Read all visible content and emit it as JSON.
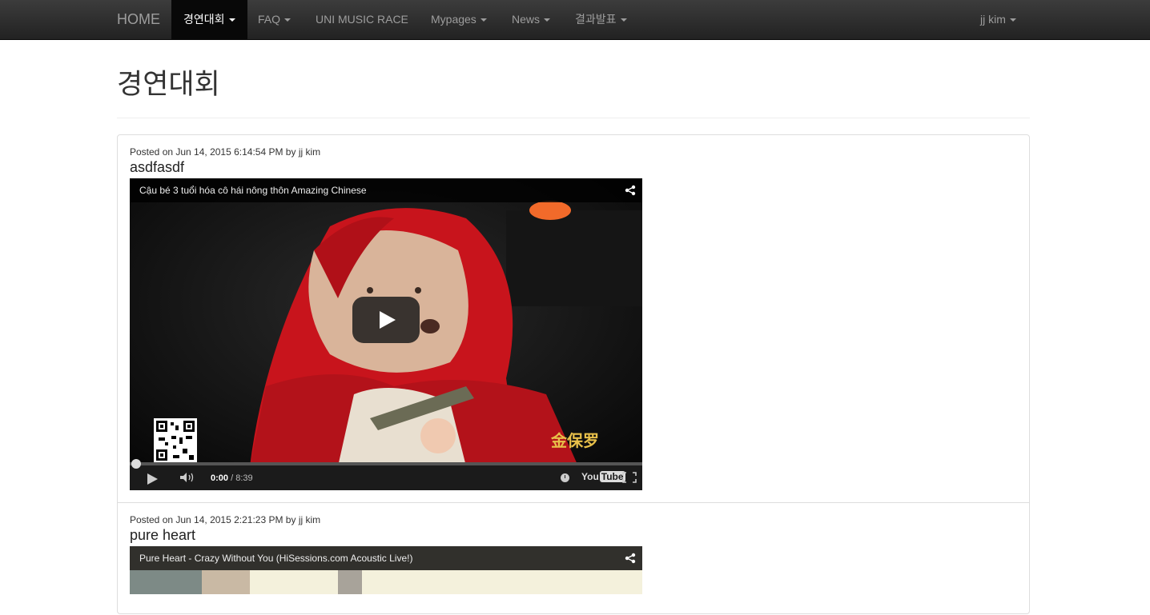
{
  "navbar": {
    "brand": "HOME",
    "items": [
      {
        "label": "경연대회",
        "active": true,
        "dropdown": true
      },
      {
        "label": "FAQ",
        "active": false,
        "dropdown": true
      },
      {
        "label": "UNI MUSIC RACE",
        "active": false,
        "dropdown": false
      },
      {
        "label": "Mypages",
        "active": false,
        "dropdown": true
      },
      {
        "label": "News",
        "active": false,
        "dropdown": true
      },
      {
        "label": "결과발표",
        "active": false,
        "dropdown": true
      }
    ],
    "user": "jj kim"
  },
  "page": {
    "title": "경연대회"
  },
  "posts": [
    {
      "meta": "Posted on Jun 14, 2015 6:14:54 PM by jj kim",
      "title": "asdfasdf",
      "video": {
        "title": "Cậu bé 3 tuổi hóa cô hái nông thôn Amazing Chinese",
        "time_current": "0:00",
        "time_total": " / 8:39",
        "progress": 0,
        "logo_text": "You",
        "logo_tube": "Tube",
        "overlay_text": "金保罗"
      }
    },
    {
      "meta": "Posted on Jun 14, 2015 2:21:23 PM by jj kim",
      "title": "pure heart",
      "video": {
        "title": "Pure Heart - Crazy Without You (HiSessions.com Acoustic Live!)"
      }
    }
  ]
}
